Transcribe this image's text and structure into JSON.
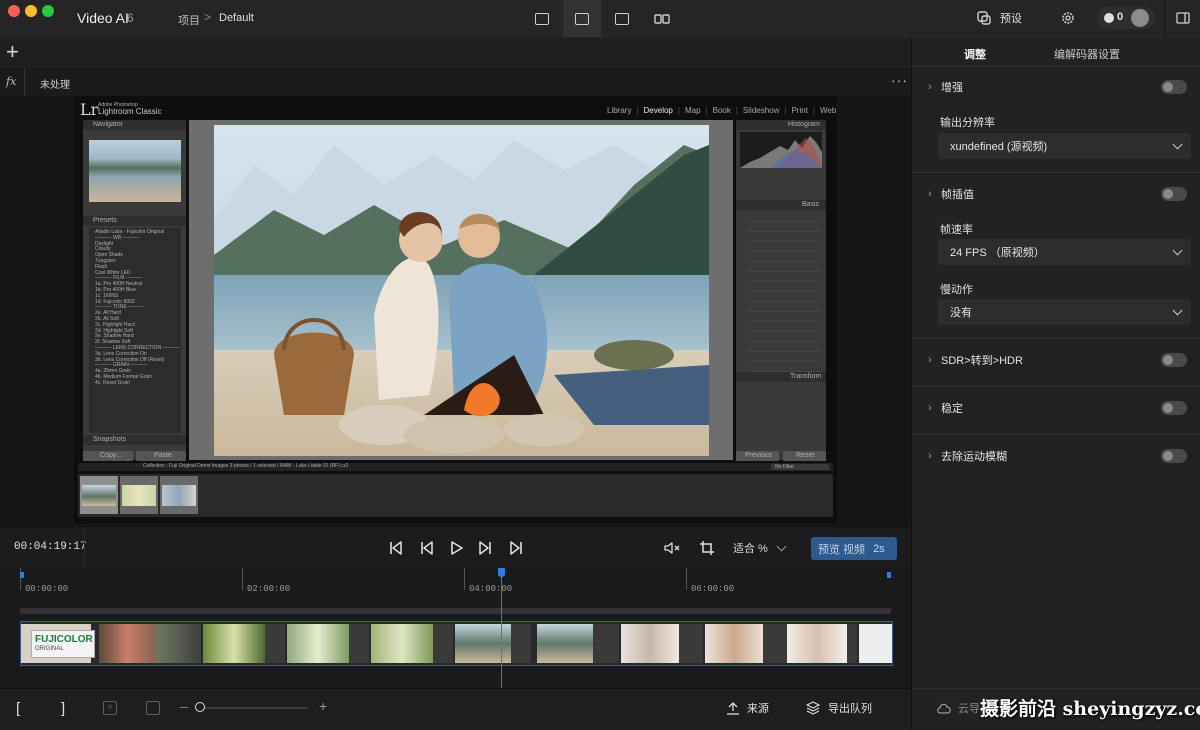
{
  "app": {
    "name": "Video AI",
    "version": "6"
  },
  "breadcrumb": {
    "root": "项目",
    "separator": ">",
    "current": "Default"
  },
  "header": {
    "preset_label": "预设",
    "credits": "0"
  },
  "viewer": {
    "process_label": "未处理",
    "fx_label": "fx"
  },
  "lightroom": {
    "logo": "Lr",
    "small_title": "Adobe Photoshop",
    "app_title": "Lightroom Classic",
    "modules": [
      "Library",
      "Develop",
      "Map",
      "Book",
      "Slideshow",
      "Print",
      "Web"
    ],
    "panels": {
      "navigator": "Navigator",
      "presets": "Presets",
      "snapshots": "Snapshots",
      "histogram": "Histogram",
      "basic": "Basic",
      "transform": "Transform",
      "copy": "Copy...",
      "paste": "Paste",
      "previous": "Previous",
      "reset": "Reset",
      "filter": "No Filter"
    },
    "preset_items": [
      "Alladin Labs - Fujicolor Original",
      "---------- WB ----------",
      "Daylight",
      "Cloudy",
      "Open Shade",
      "Tungsten",
      "Flash",
      "Cool White LED",
      "---------- FILM ----------",
      "1a. Pro 400H Neutral",
      "1b. Pro 400H Blue",
      "1c. 160NS",
      "1d. Fujicolor 800Z",
      "---------- TONE ----------",
      "2a. All Hard",
      "2b. All Soft",
      "2c. Highlight Hard",
      "2d. Highlight Soft",
      "2e. Shadow Hard",
      "2f. Shadow Soft",
      "---------- LENS CORRECTION ----------",
      "3a. Lens Correction On",
      "3b. Lens Correction Off (Reset)",
      "---------- GRAIN ----------",
      "4a. 35mm Grain",
      "4b. Medium Format Grain",
      "4c. Reset Grain"
    ],
    "filmstrip_info": "Collection : Fuji Original Demo Images    3 photos / 1 selected / RAW - Luke Liable 01 (RF).cr2"
  },
  "controls": {
    "timecode": "00:04:19:17",
    "zoom_label": "适合 %",
    "preview_label": "预览 视频",
    "preview_duration": "2s"
  },
  "timeline": {
    "ruler": [
      "00:00:00",
      "02:00:00",
      "04:00:00",
      "06:00:00"
    ],
    "clip_text": "FUJICOLOR",
    "clip_subtext": "ORIGINAL"
  },
  "bottom": {
    "source_label": "来源",
    "export_queue_label": "导出队列",
    "cloud_label": "云导出"
  },
  "right_panel": {
    "tabs": [
      "调整",
      "编解码器设置"
    ],
    "sections": [
      {
        "title": "增强",
        "fields": [
          {
            "label": "输出分辨率",
            "value": "xundefined (源视频)"
          }
        ]
      },
      {
        "title": "帧插值",
        "fields": [
          {
            "label": "帧速率",
            "value": "24 FPS （原视频）"
          },
          {
            "label": "慢动作",
            "value": "没有"
          }
        ]
      },
      {
        "title": "SDR>转到>HDR",
        "fields": []
      },
      {
        "title": "稳定",
        "fields": []
      },
      {
        "title": "去除运动模糊",
        "fields": []
      }
    ]
  },
  "watermark": "摄影前沿 sheyingzyz.com",
  "colors": {
    "accent": "#2f7de1",
    "preview_button": "#2d5a8f",
    "background": "#1d1d1f"
  }
}
